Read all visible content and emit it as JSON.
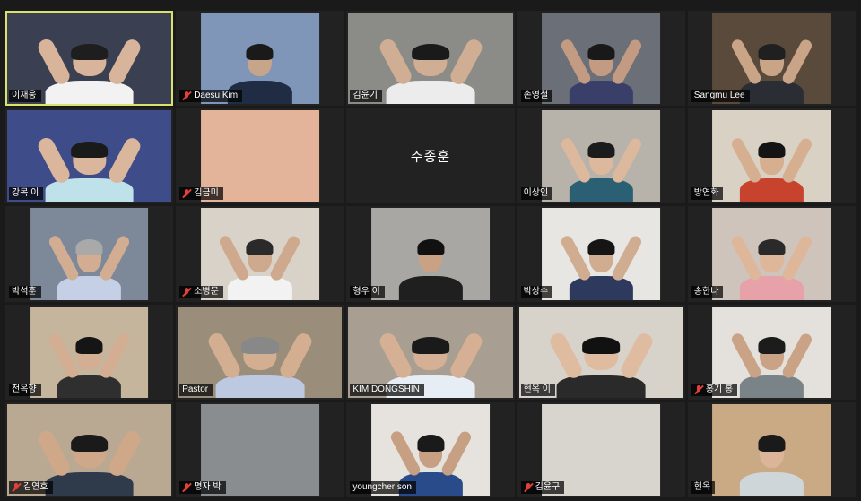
{
  "participants": [
    {
      "name": "이재웅",
      "muted": false,
      "active": true,
      "video": "full",
      "bg": "#3a3f52",
      "skin": "#d8b59a",
      "shirt": "#f2f2f2",
      "hair": "#1e1e1e",
      "pose": "heart"
    },
    {
      "name": "Daesu Kim",
      "muted": true,
      "active": false,
      "video": "center",
      "bg": "#7f96b8",
      "skin": "#c7a58a",
      "shirt": "#1f2c44",
      "hair": "#1a1a1a",
      "pose": "stand"
    },
    {
      "name": "김윤기",
      "muted": false,
      "active": false,
      "video": "full",
      "bg": "#8b8b88",
      "skin": "#cfae94",
      "shirt": "#ececec",
      "hair": "#1a1a1a",
      "pose": "heart"
    },
    {
      "name": "손영철",
      "muted": false,
      "active": false,
      "video": "center",
      "bg": "#6b6f77",
      "skin": "#c39b82",
      "shirt": "#3a3f6a",
      "hair": "#191919",
      "pose": "heart"
    },
    {
      "name": "Sangmu Lee",
      "muted": false,
      "active": false,
      "video": "center",
      "bg": "#5a4a3c",
      "skin": "#c9a487",
      "shirt": "#2a2d33",
      "hair": "#202020",
      "pose": "heart"
    },
    {
      "name": "강목 이",
      "muted": false,
      "active": false,
      "video": "full",
      "bg": "#3e4c8a",
      "skin": "#d9b69c",
      "shirt": "#bfe1ea",
      "hair": "#1a1a1a",
      "pose": "heart"
    },
    {
      "name": "김금미",
      "muted": true,
      "active": false,
      "video": "center",
      "bg": "#e4b49a",
      "skin": "#e4b49a",
      "shirt": "#e4b49a",
      "hair": "#e4b49a",
      "pose": "none"
    },
    {
      "name": "주종훈",
      "muted": false,
      "active": false,
      "video": "off",
      "bg": "#222222",
      "skin": "#222",
      "shirt": "#222",
      "hair": "#222",
      "pose": "none"
    },
    {
      "name": "이상인",
      "muted": false,
      "active": false,
      "video": "center",
      "bg": "#b7b2aa",
      "skin": "#dcb89d",
      "shirt": "#2b5f73",
      "hair": "#1b1b1b",
      "pose": "heart"
    },
    {
      "name": "방연화",
      "muted": false,
      "active": false,
      "video": "center",
      "bg": "#d9d2c4",
      "skin": "#d6ae90",
      "shirt": "#c8432e",
      "hair": "#141414",
      "pose": "heart"
    },
    {
      "name": "박석훈",
      "muted": false,
      "active": false,
      "video": "center",
      "bg": "#7d8898",
      "skin": "#d2ad92",
      "shirt": "#c5cfe6",
      "hair": "#a9a9a9",
      "pose": "heart"
    },
    {
      "name": "소병문",
      "muted": true,
      "active": false,
      "video": "center",
      "bg": "#d8d2c8",
      "skin": "#cfa98d",
      "shirt": "#f2f2f2",
      "hair": "#2a2a2a",
      "pose": "heart"
    },
    {
      "name": "형우 이",
      "muted": false,
      "active": false,
      "video": "center",
      "bg": "#a9a7a3",
      "skin": "#c9a285",
      "shirt": "#1f1f1f",
      "hair": "#111111",
      "pose": "stand"
    },
    {
      "name": "박상수",
      "muted": false,
      "active": false,
      "video": "center",
      "bg": "#e8e6e3",
      "skin": "#d0ac90",
      "shirt": "#2d3a5e",
      "hair": "#151515",
      "pose": "heart"
    },
    {
      "name": "송한나",
      "muted": false,
      "active": false,
      "video": "center",
      "bg": "#cfc4bb",
      "skin": "#deb79a",
      "shirt": "#e6a1a9",
      "hair": "#2a2a2a",
      "pose": "heart"
    },
    {
      "name": "전옥향",
      "muted": false,
      "active": false,
      "video": "center",
      "bg": "#c4b59c",
      "skin": "#d4ae92",
      "shirt": "#2f2f2f",
      "hair": "#151515",
      "pose": "heart"
    },
    {
      "name": "Pastor",
      "muted": false,
      "active": false,
      "video": "full",
      "bg": "#9a8d7a",
      "skin": "#d3ae90",
      "shirt": "#bcc9e0",
      "hair": "#888888",
      "pose": "heart"
    },
    {
      "name": "KIM DONGSHIN",
      "muted": false,
      "active": false,
      "video": "full",
      "bg": "#a89f92",
      "skin": "#d6b095",
      "shirt": "#e7edf4",
      "hair": "#1a1a1a",
      "pose": "heart"
    },
    {
      "name": "현옥 이",
      "muted": false,
      "active": false,
      "video": "full",
      "bg": "#d7d2ca",
      "skin": "#dfbb9f",
      "shirt": "#2a2a2a",
      "hair": "#111111",
      "pose": "heart"
    },
    {
      "name": "홍기 홍",
      "muted": true,
      "active": false,
      "video": "center",
      "bg": "#e4e1dc",
      "skin": "#caa386",
      "shirt": "#7a8387",
      "hair": "#1c1c1c",
      "pose": "heart"
    },
    {
      "name": "김연호",
      "muted": true,
      "active": false,
      "video": "full",
      "bg": "#b9a892",
      "skin": "#cfa88a",
      "shirt": "#2f3b4a",
      "hair": "#1a1a1a",
      "pose": "heart"
    },
    {
      "name": "명자 박",
      "muted": true,
      "active": false,
      "video": "center",
      "bg": "#8a8d90",
      "skin": "#8a8d90",
      "shirt": "#8a8d90",
      "hair": "#8a8d90",
      "pose": "none"
    },
    {
      "name": "youngcher son",
      "muted": false,
      "active": false,
      "video": "center",
      "bg": "#e6e3de",
      "skin": "#c79f82",
      "shirt": "#2a4b8a",
      "hair": "#1a1a1a",
      "pose": "heart"
    },
    {
      "name": "김윤구",
      "muted": true,
      "active": false,
      "video": "center",
      "bg": "#d8d5cf",
      "skin": "#d8d5cf",
      "shirt": "#d8d5cf",
      "hair": "#d8d5cf",
      "pose": "none"
    },
    {
      "name": "현옥",
      "muted": false,
      "active": false,
      "video": "center",
      "bg": "#caa985",
      "skin": "#dcb598",
      "shirt": "#cfd6d9",
      "hair": "#1a1a1a",
      "pose": "stand"
    }
  ]
}
